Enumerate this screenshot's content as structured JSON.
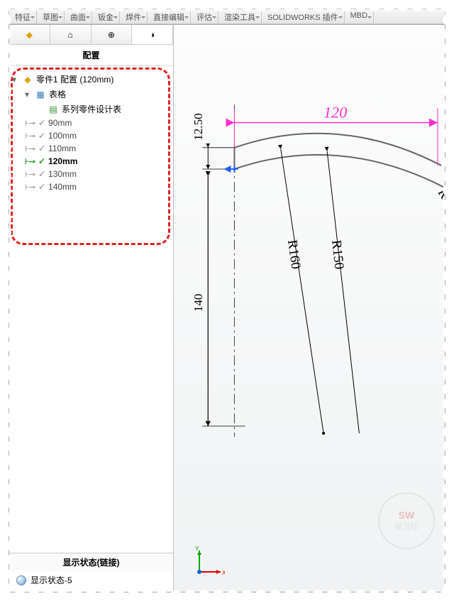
{
  "ribbon": {
    "tabs": [
      "特征",
      "草图",
      "曲面",
      "钣金",
      "焊件",
      "直接编辑",
      "评估",
      "渲染工具",
      "SOLIDWORKS 插件",
      "MBD"
    ]
  },
  "side": {
    "title": "配置",
    "rootLabel": "零件1 配置  (120mm)",
    "tablesLabel": "表格",
    "designTableLabel": "系列零件设计表",
    "configs": [
      {
        "label": "90mm",
        "active": false
      },
      {
        "label": "100mm",
        "active": false
      },
      {
        "label": "110mm",
        "active": false
      },
      {
        "label": "120mm",
        "active": true
      },
      {
        "label": "130mm",
        "active": false
      },
      {
        "label": "140mm",
        "active": false
      }
    ],
    "displayHead": "显示状态(链接)",
    "displayItem": "显示状态-5"
  },
  "dims": {
    "top": "120",
    "height12": "12.50",
    "height140": "140",
    "r160": "R160",
    "r150": "R150"
  },
  "triad": {
    "x": "X",
    "y": "Y"
  },
  "watermark": {
    "line1": "SW",
    "line2": "研习社"
  }
}
